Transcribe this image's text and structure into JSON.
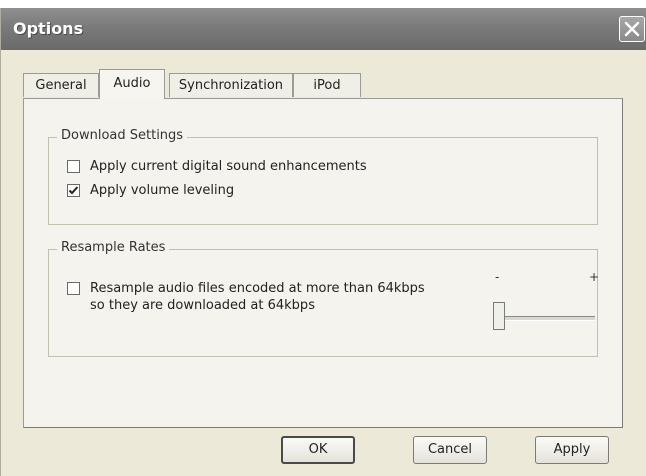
{
  "window": {
    "title": "Options"
  },
  "tabs": [
    {
      "label": "General",
      "active": false
    },
    {
      "label": "Audio",
      "active": true
    },
    {
      "label": "Synchronization",
      "active": false
    },
    {
      "label": "iPod",
      "active": false
    }
  ],
  "download_settings": {
    "title": "Download Settings",
    "options": [
      {
        "label": "Apply current digital sound enhancements",
        "checked": false
      },
      {
        "label": "Apply volume leveling",
        "checked": true
      }
    ]
  },
  "resample_rates": {
    "title": "Resample Rates",
    "option": {
      "line1": "Resample audio files encoded at more than 64kbps",
      "line2": "so they are downloaded at 64kbps",
      "checked": false
    },
    "slider": {
      "min_label": "-",
      "max_label": "+",
      "level": 0.0
    }
  },
  "buttons": {
    "ok": "OK",
    "cancel": "Cancel",
    "apply": "Apply"
  },
  "icons": {
    "close": "close-icon",
    "checkmark": "checkmark-icon"
  },
  "colors": {
    "titlebar": "#7a7a7a",
    "dialog_bg": "#ece9d8",
    "panel_bg": "#f4f3ee"
  }
}
